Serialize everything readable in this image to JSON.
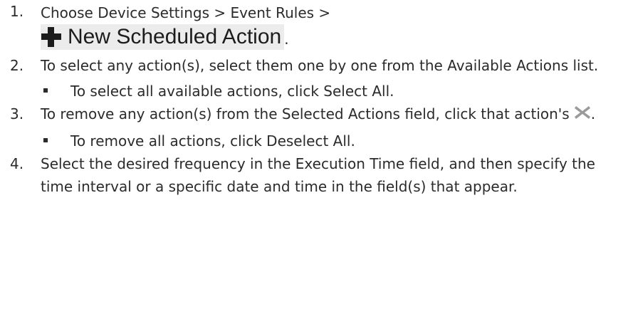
{
  "steps": [
    {
      "number": "1.",
      "text": "Choose Device Settings > Event Rules >",
      "button_label": "New Scheduled Action",
      "button_icon": "plus-icon",
      "trailing": "."
    },
    {
      "number": "2.",
      "text": "To select any action(s), select them one by one from the Available Actions list.",
      "sub": "To select all available actions, click Select All."
    },
    {
      "number": "3.",
      "text": "To remove any action(s) from the Selected Actions field, click that action's",
      "icon": "close-x-icon",
      "trailing": ".",
      "sub": "To remove all actions, click Deselect All."
    },
    {
      "number": "4.",
      "text": "Select the desired frequency in the Execution Time field, and then specify the time interval or a specific date and time in the field(s) that appear."
    }
  ],
  "colors": {
    "text": "#2b2b2b",
    "button_bg": "#ececec",
    "x_icon": "#9a9a9a"
  }
}
